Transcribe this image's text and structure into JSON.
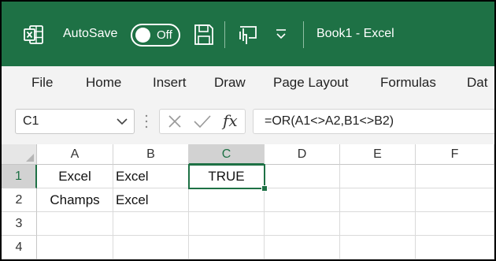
{
  "titlebar": {
    "autosave_label": "AutoSave",
    "autosave_state": "Off",
    "document_title": "Book1  -  Excel",
    "accent_color": "#1e7145"
  },
  "ribbon": {
    "tabs": [
      "File",
      "Home",
      "Insert",
      "Draw",
      "Page Layout",
      "Formulas",
      "Dat"
    ]
  },
  "formula_bar": {
    "name_box": "C1",
    "fx_label": "fx",
    "formula": "=OR(A1<>A2,B1<>B2)"
  },
  "sheet": {
    "columns": [
      "A",
      "B",
      "C",
      "D",
      "E",
      "F"
    ],
    "rows": [
      "1",
      "2",
      "3",
      "4"
    ],
    "selected_column": "C",
    "selected_row": "1",
    "cells": {
      "A1": "Excel",
      "B1": "Excel",
      "C1": "TRUE",
      "A2": "Champs",
      "B2": "Excel"
    }
  },
  "icons": [
    "excel-logo-icon",
    "save-icon",
    "touch-mode-icon",
    "customize-qat-icon",
    "chevron-down-icon",
    "cancel-icon",
    "enter-icon",
    "fx-icon"
  ]
}
